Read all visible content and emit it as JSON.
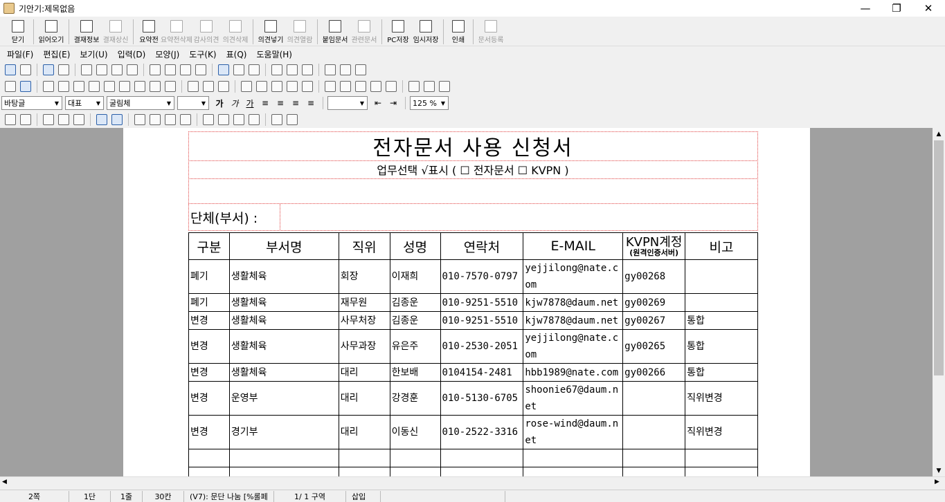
{
  "window": {
    "title": "기안기:제목없음",
    "minimize": "—",
    "restore": "❐",
    "close": "✕"
  },
  "toolbar": [
    {
      "label": "닫기",
      "icon": "exit-icon",
      "enabled": true
    },
    {
      "label": "읽어오기",
      "icon": "open-icon",
      "enabled": true
    },
    {
      "label": "결재정보",
      "icon": "approval-info-icon",
      "enabled": true
    },
    {
      "label": "결재상신",
      "icon": "submit-icon",
      "enabled": false
    },
    {
      "label": "요약전",
      "icon": "summary-icon",
      "enabled": true
    },
    {
      "label": "요약전삭제",
      "icon": "summary-delete-icon",
      "enabled": false
    },
    {
      "label": "감사의견",
      "icon": "audit-opinion-icon",
      "enabled": false
    },
    {
      "label": "의견삭제",
      "icon": "opinion-delete-icon",
      "enabled": false
    },
    {
      "label": "의견넣기",
      "icon": "opinion-insert-icon",
      "enabled": true
    },
    {
      "label": "의견열람",
      "icon": "opinion-view-icon",
      "enabled": false
    },
    {
      "label": "붙임문서",
      "icon": "attach-icon",
      "enabled": true
    },
    {
      "label": "관련문서",
      "icon": "related-doc-icon",
      "enabled": false
    },
    {
      "label": "PC저장",
      "icon": "pc-save-icon",
      "enabled": true
    },
    {
      "label": "임시저장",
      "icon": "temp-save-icon",
      "enabled": true
    },
    {
      "label": "인쇄",
      "icon": "print-icon",
      "enabled": true
    },
    {
      "label": "문서등록",
      "icon": "register-icon",
      "enabled": false
    }
  ],
  "menu": [
    "파일(F)",
    "편집(E)",
    "보기(U)",
    "입력(D)",
    "모양(J)",
    "도구(K)",
    "표(Q)",
    "도움말(H)"
  ],
  "format": {
    "style": "바탕글",
    "lang": "대표",
    "font": "굴림체",
    "size": "",
    "bold": "가",
    "italic": "가",
    "underline": "가",
    "zoom": "125 %"
  },
  "document": {
    "title": "전자문서 사용 신청서",
    "subtitle": "업무선택 √표시 ( ☐ 전자문서 ☐ KVPN )",
    "org_label": "단체(부서) :",
    "table": {
      "headers": [
        "구분",
        "부서명",
        "직위",
        "성명",
        "연락처",
        "E-MAIL",
        "KVPN계정",
        "비고"
      ],
      "kvpn_note": "(원격인증서버)",
      "rows": [
        [
          "폐기",
          "생활체육",
          "회장",
          "이재희",
          "010-7570-0797",
          "yejjilong@nate.com",
          "gy00268",
          ""
        ],
        [
          "폐기",
          "생활체육",
          "재무원",
          "김종운",
          "010-9251-5510",
          "kjw7878@daum.net",
          "gy00269",
          ""
        ],
        [
          "변경",
          "생활체육",
          "사무처장",
          "김종운",
          "010-9251-5510",
          "kjw7878@daum.net",
          "gy00267",
          "통합"
        ],
        [
          "변경",
          "생활체육",
          "사무과장",
          "유은주",
          "010-2530-2051",
          "yejjilong@nate.com",
          "gy00265",
          "통합"
        ],
        [
          "변경",
          "생활체육",
          "대리",
          "한보배",
          "0104154-2481",
          "hbb1989@nate.com",
          "gy00266",
          "통합"
        ],
        [
          "변경",
          "운영부",
          "대리",
          "강경훈",
          "010-5130-6705",
          "shoonie67@daum.net",
          "",
          "직위변경"
        ],
        [
          "변경",
          "경기부",
          "대리",
          "이동신",
          "010-2522-3316",
          "rose-wind@daum.net",
          "",
          "직위변경"
        ],
        [
          "",
          "",
          "",
          "",
          "",
          "",
          "",
          ""
        ],
        [
          "",
          "",
          "",
          "",
          "",
          "",
          "",
          ""
        ]
      ]
    }
  },
  "status": [
    "2쪽",
    "1단",
    "1줄",
    "30칸",
    "(V7): 문단 나눔 [%롤페",
    "1/ 1 구역",
    "삽입"
  ]
}
